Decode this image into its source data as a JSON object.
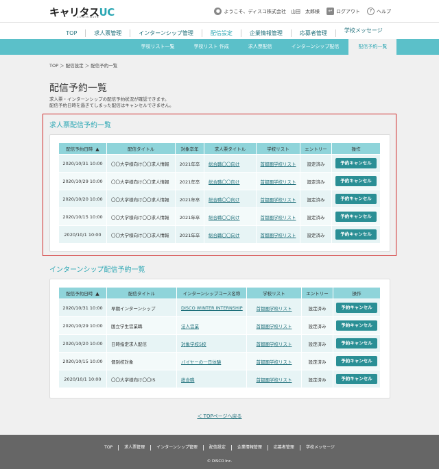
{
  "header": {
    "logo_main": "キャリタス",
    "logo_uc": "UC",
    "logo_sub": "CONTRIBUTE",
    "welcome": "ようこそ、ディスコ株式会社　山田　太郎様",
    "logout": "ログアウト",
    "help": "ヘルプ"
  },
  "gnav": [
    "TOP",
    "求人票管理",
    "インターンシップ管理",
    "配信設定",
    "企業情報管理",
    "応募者管理",
    "学校メッセージ"
  ],
  "subnav": [
    "学校リスト一覧",
    "学校リスト 作成",
    "求人票配信",
    "インターンシップ配信",
    "配信予約一覧"
  ],
  "breadcrumb": "TOP ＞ 配信設定 ＞ 配信予約一覧",
  "page_title": "配信予約一覧",
  "desc1": "求人票・インターンシップの配信予約状況が確認できます。",
  "desc2": "配信予約日時を過ぎてしまった配信はキャンセルできません。",
  "job": {
    "title": "求人票配信予約一覧",
    "headers": [
      "配信予約日時",
      "配信タイトル",
      "対象卒年",
      "求人票タイトル",
      "学校リスト",
      "エントリー",
      "操作"
    ],
    "rows": [
      [
        "2020/10/31 10:00",
        "〇〇大学様向け〇〇求人情報",
        "2021年卒",
        "総合職〇〇向け",
        "首都圏学校リスト",
        "設定済み",
        "予約キャンセル"
      ],
      [
        "2020/10/29 10:00",
        "〇〇大学様向け〇〇求人情報",
        "2021年卒",
        "総合職〇〇向け",
        "首都圏学校リスト",
        "設定済み",
        "予約キャンセル"
      ],
      [
        "2020/10/20 10:00",
        "〇〇大学様向け〇〇求人情報",
        "2021年卒",
        "総合職〇〇向け",
        "首都圏学校リスト",
        "設定済み",
        "予約キャンセル"
      ],
      [
        "2020/10/15 10:00",
        "〇〇大学様向け〇〇求人情報",
        "2021年卒",
        "総合職〇〇向け",
        "首都圏学校リスト",
        "設定済み",
        "予約キャンセル"
      ],
      [
        "2020/10/1 10:00",
        "〇〇大学様向け〇〇求人情報",
        "2021年卒",
        "総合職〇〇向け",
        "首都圏学校リスト",
        "設定済み",
        "予約キャンセル"
      ]
    ]
  },
  "intern": {
    "title": "インターンシップ配信予約一覧",
    "headers": [
      "配信予約日時",
      "配信タイトル",
      "インターンシップコース名称",
      "学校リスト",
      "エントリー",
      "操作"
    ],
    "rows": [
      [
        "2020/10/31 10:00",
        "早期インターンシップ",
        "DISCO WINTER INTERNSHIP",
        "首都圏学校リスト",
        "設定済み",
        "予約キャンセル"
      ],
      [
        "2020/10/29 10:00",
        "国立学生営業職",
        "法人営業",
        "首都圏学校リスト",
        "設定済み",
        "予約キャンセル"
      ],
      [
        "2020/10/20 10:00",
        "日時指定求人配信",
        "対象学校5校",
        "首都圏学校リスト",
        "設定済み",
        "予約キャンセル"
      ],
      [
        "2020/10/15 10:00",
        "個別校対象",
        "バイヤーの一日体験",
        "首都圏学校リスト",
        "設定済み",
        "予約キャンセル"
      ],
      [
        "2020/10/1 10:00",
        "〇〇大学様向け〇〇IS",
        "総合職",
        "首都圏学校リスト",
        "設定済み",
        "予約キャンセル"
      ]
    ]
  },
  "back": "＜ TOPページへ戻る",
  "footer_nav": [
    "TOP",
    "求人票管理",
    "インターンシップ管理",
    "配信設定",
    "企業情報管理",
    "応募者管理",
    "学校メッセージ"
  ],
  "copyright": "© DISCO Inc."
}
